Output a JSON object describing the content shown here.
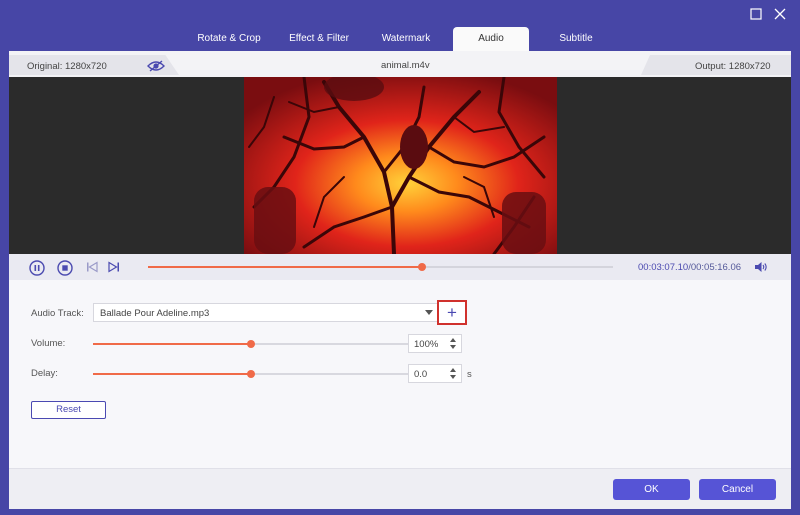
{
  "window": {
    "controls": {
      "maximize_icon": "square-icon",
      "close_icon": "close-icon"
    }
  },
  "tabs": [
    {
      "label": "Rotate & Crop",
      "active": false
    },
    {
      "label": "Effect & Filter",
      "active": false
    },
    {
      "label": "Watermark",
      "active": false
    },
    {
      "label": "Audio",
      "active": true
    },
    {
      "label": "Subtitle",
      "active": false
    }
  ],
  "infobar": {
    "original": "Original: 1280x720",
    "filename": "animal.m4v",
    "output": "Output: 1280x720",
    "eye_icon": "eye-off-icon"
  },
  "player": {
    "current_time": "00:03:07.10",
    "separator": "/",
    "total_time": "00:05:16.06",
    "progress": 0.59
  },
  "audio": {
    "track_label": "Audio Track:",
    "track_value": "Ballade Pour Adeline.mp3",
    "volume_label": "Volume:",
    "volume_value": "100%",
    "volume_level": 0.5,
    "delay_label": "Delay:",
    "delay_value": "0.0",
    "delay_unit": "s",
    "delay_level": 0.5,
    "add_label": "+"
  },
  "buttons": {
    "reset": "Reset",
    "ok": "OK",
    "cancel": "Cancel"
  },
  "colors": {
    "accent": "#4b4ab0",
    "slider": "#f06a48",
    "highlight": "#d0312d"
  }
}
